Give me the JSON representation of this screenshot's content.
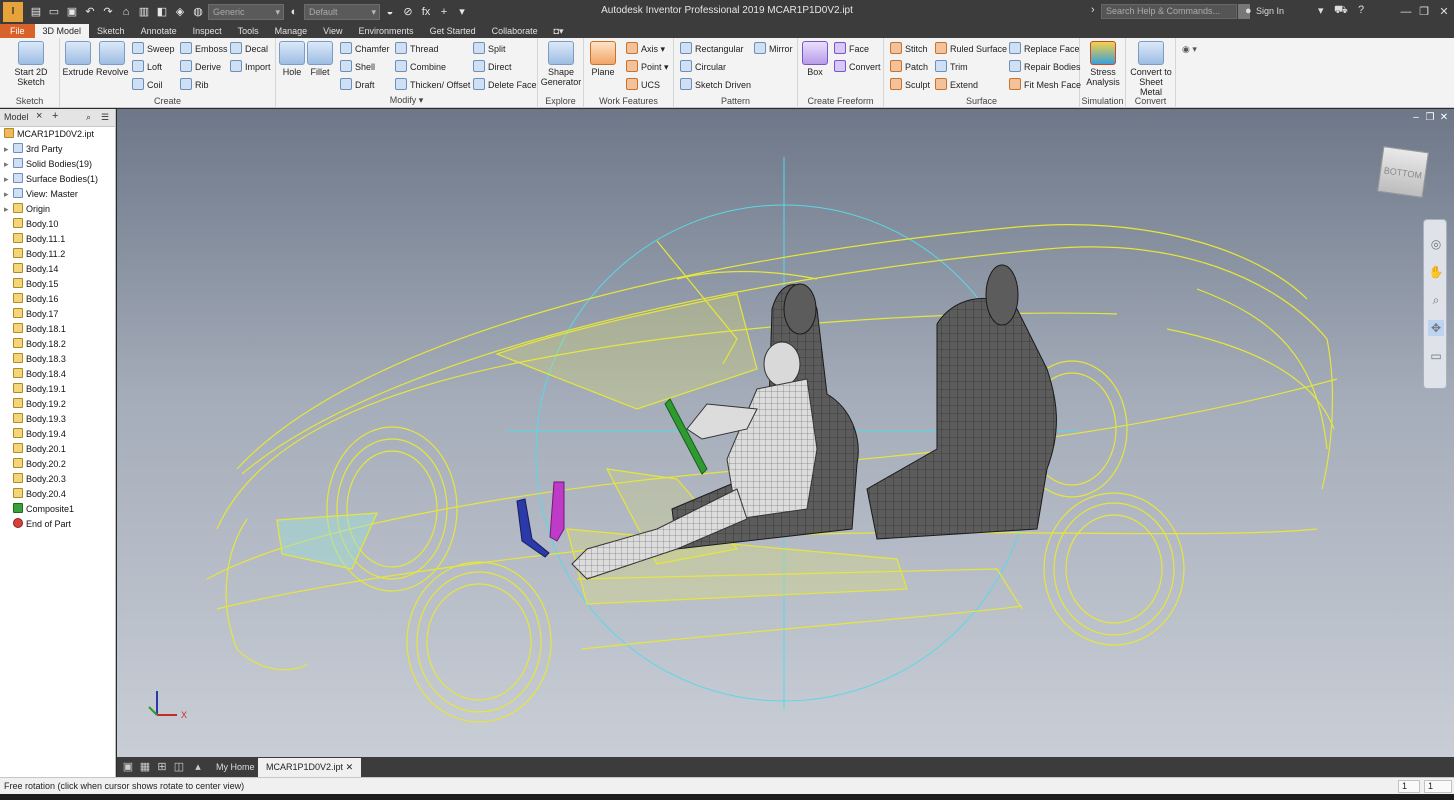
{
  "app": {
    "logo_text": "I PRO",
    "title": "Autodesk Inventor Professional 2019   MCAR1P1D0V2.ipt",
    "search_placeholder": "Search Help & Commands...",
    "sign_in": "Sign In",
    "material_combo": "Generic",
    "appearance_combo": "Default",
    "formula_icon": "fx"
  },
  "ribbon_tabs": [
    "File",
    "3D Model",
    "Sketch",
    "Annotate",
    "Inspect",
    "Tools",
    "Manage",
    "View",
    "Environments",
    "Get Started",
    "Collaborate"
  ],
  "ribbon": {
    "sketch": {
      "label": "Sketch",
      "start_sketch": "Start 2D Sketch"
    },
    "create": {
      "label": "Create",
      "extrude": "Extrude",
      "revolve": "Revolve",
      "sweep": "Sweep",
      "emboss": "Emboss",
      "decal": "Decal",
      "loft": "Loft",
      "derive": "Derive",
      "import": "Import",
      "coil": "Coil",
      "rib": "Rib"
    },
    "modify": {
      "label": "Modify",
      "hole": "Hole",
      "fillet": "Fillet",
      "chamfer": "Chamfer",
      "thread": "Thread",
      "split": "Split",
      "shell": "Shell",
      "combine": "Combine",
      "direct": "Direct",
      "draft": "Draft",
      "thicken_offset": "Thicken/ Offset",
      "delete_face": "Delete Face"
    },
    "explore": {
      "label": "Explore",
      "shape_generator": "Shape Generator"
    },
    "work_features": {
      "label": "Work Features",
      "plane": "Plane",
      "axis": "Axis",
      "point": "Point",
      "ucs": "UCS"
    },
    "pattern": {
      "label": "Pattern",
      "rectangular": "Rectangular",
      "mirror": "Mirror",
      "circular": "Circular",
      "sketch_driven": "Sketch Driven"
    },
    "create_freeform": {
      "label": "Create Freeform",
      "box": "Box",
      "face": "Face",
      "convert": "Convert"
    },
    "surface": {
      "label": "Surface",
      "stitch": "Stitch",
      "ruled_surface": "Ruled Surface",
      "replace_face": "Replace Face",
      "patch": "Patch",
      "trim": "Trim",
      "repair_bodies": "Repair Bodies",
      "sculpt": "Sculpt",
      "extend": "Extend",
      "fit_mesh_face": "Fit Mesh Face"
    },
    "simulation": {
      "label": "Simulation",
      "stress_analysis": "Stress Analysis"
    },
    "convert": {
      "label": "Convert",
      "to_sheet_metal": "Convert to Sheet Metal"
    }
  },
  "browser": {
    "tab": "Model",
    "root": "MCAR1P1D0V2.ipt",
    "items": [
      "3rd Party",
      "Solid Bodies(19)",
      "Surface Bodies(1)",
      "View: Master",
      "Origin",
      "Body.10",
      "Body.11.1",
      "Body.11.2",
      "Body.14",
      "Body.15",
      "Body.16",
      "Body.17",
      "Body.18.1",
      "Body.18.2",
      "Body.18.3",
      "Body.18.4",
      "Body.19.1",
      "Body.19.2",
      "Body.19.3",
      "Body.19.4",
      "Body.20.1",
      "Body.20.2",
      "Body.20.3",
      "Body.20.4",
      "Composite1",
      "End of Part"
    ]
  },
  "viewport": {
    "viewcube_label": "BOTTOM",
    "triad_x": "X"
  },
  "doc_tabs": {
    "home": "My Home",
    "active": "MCAR1P1D0V2.ipt"
  },
  "status": {
    "message": "Free rotation (click when cursor shows rotate to center view)",
    "count1": "1",
    "count2": "1"
  },
  "colors": {
    "accent_file": "#d9622b",
    "wireframe": "#e6e63a",
    "seat": "#5c5c5c",
    "steering": "#2f9a2f",
    "pedal_magenta": "#c03ac8",
    "pedal_blue": "#2a3aa8",
    "sphere": "#59d8e8"
  }
}
